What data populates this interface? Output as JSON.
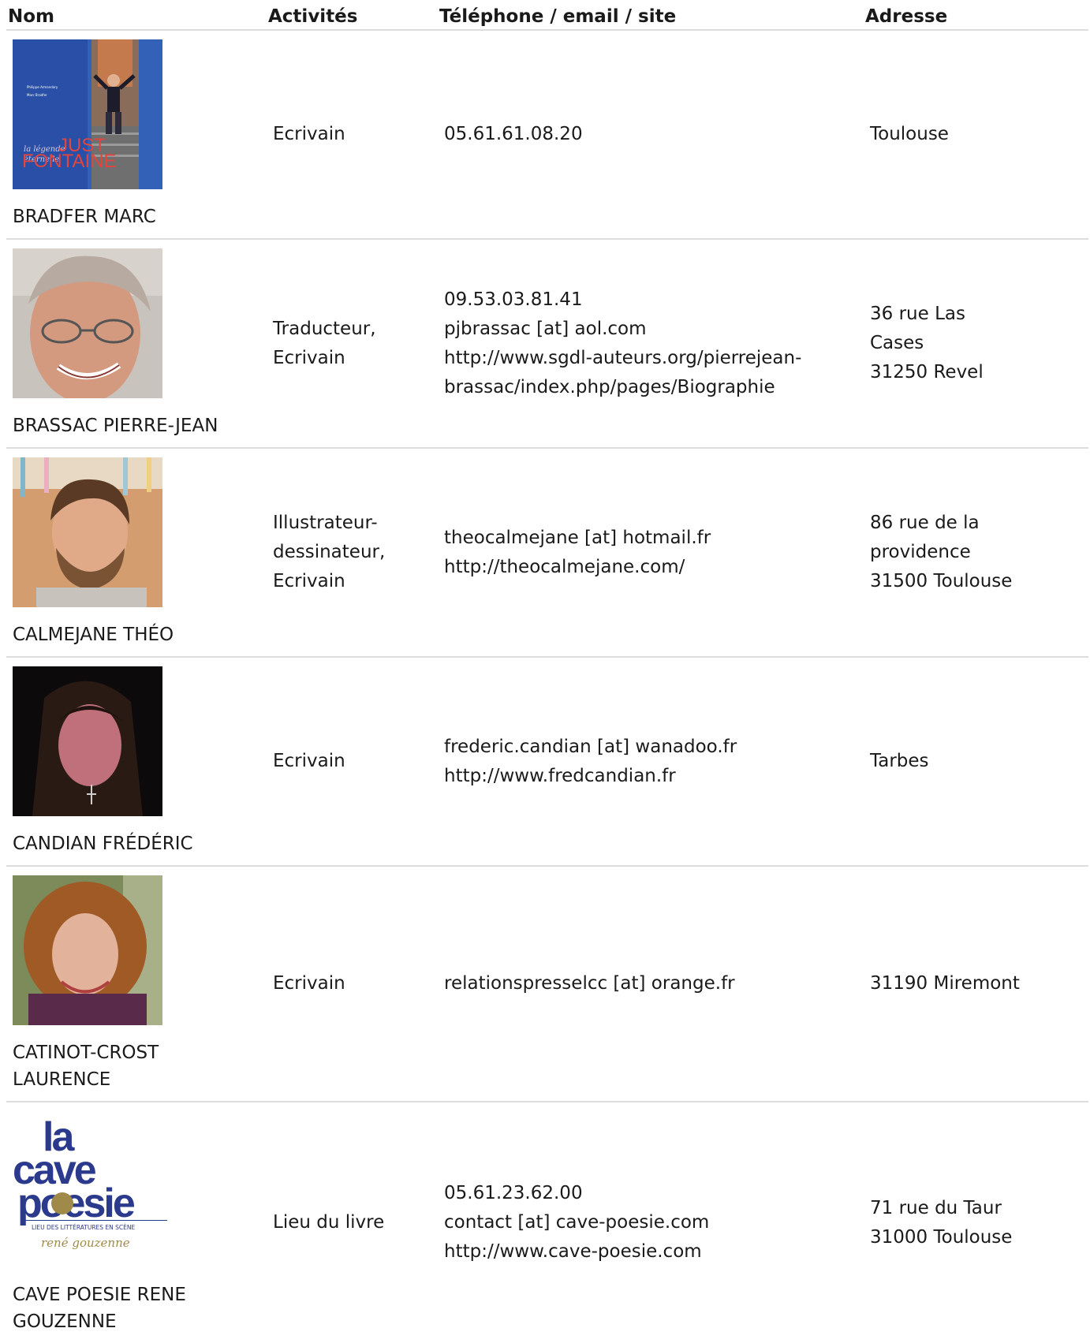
{
  "headers": {
    "nom": "Nom",
    "activites": "Activités",
    "contact": "Téléphone / email / site",
    "adresse": "Adresse"
  },
  "rows": [
    {
      "name": "BRADFER MARC",
      "activity": [
        "Ecrivain"
      ],
      "contact": [
        "05.61.61.08.20"
      ],
      "address": [
        "Toulouse"
      ],
      "image_text": {
        "line1": "la légende",
        "line2": "éternelle",
        "line3": "JUST",
        "line4": "FONTAINE"
      }
    },
    {
      "name": "BRASSAC PIERRE-JEAN",
      "activity": [
        "Traducteur,",
        "Ecrivain"
      ],
      "contact": [
        "09.53.03.81.41",
        "pjbrassac [at] aol.com",
        "http://www.sgdl-auteurs.org/pierrejean-",
        "brassac/index.php/pages/Biographie"
      ],
      "address": [
        "36 rue Las",
        "Cases",
        "31250 Revel"
      ]
    },
    {
      "name": "CALMEJANE THÉO",
      "activity": [
        "Illustrateur-",
        "dessinateur,",
        "Ecrivain"
      ],
      "contact": [
        "theocalmejane [at] hotmail.fr",
        "http://theocalmejane.com/"
      ],
      "address": [
        "86 rue de la",
        "providence",
        "31500 Toulouse"
      ]
    },
    {
      "name": "CANDIAN FRÉDÉRIC",
      "activity": [
        "Ecrivain"
      ],
      "contact": [
        "frederic.candian [at] wanadoo.fr",
        "http://www.fredcandian.fr"
      ],
      "address": [
        "Tarbes"
      ]
    },
    {
      "name": "CATINOT-CROST LAURENCE",
      "activity": [
        "Ecrivain"
      ],
      "contact": [
        "relationspresselcc [at] orange.fr"
      ],
      "address": [
        "31190 Miremont"
      ]
    },
    {
      "name": "CAVE POESIE RENE GOUZENNE",
      "activity": [
        "Lieu du livre"
      ],
      "contact": [
        "05.61.23.62.00",
        "contact [at] cave-poesie.com",
        "http://www.cave-poesie.com"
      ],
      "address": [
        "71 rue du Taur",
        "31000 Toulouse"
      ],
      "logo_text": {
        "la": "la",
        "cave": "cave",
        "poesie": "poesie",
        "tagline": "LIEU DES LITTÉRATURES EN SCÈNE",
        "signature": "rené gouzenne"
      }
    }
  ],
  "colors": {
    "border": "#dddddd",
    "text": "#1a1a1a",
    "logo_blue": "#2b3a8c",
    "logo_gold": "#a08a4a"
  }
}
